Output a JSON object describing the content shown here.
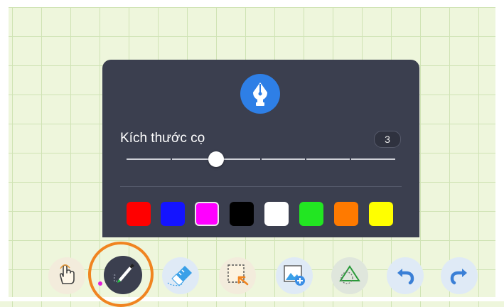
{
  "brush_panel": {
    "icon": "fountain-pen-nib-icon",
    "size_label": "Kích thước cọ",
    "size_value": "3",
    "size_slider": {
      "min": 1,
      "max": 7,
      "value": 3
    },
    "colors": [
      {
        "name": "red",
        "hex": "#ff0000",
        "selected": false
      },
      {
        "name": "blue",
        "hex": "#1414ff",
        "selected": false
      },
      {
        "name": "magenta",
        "hex": "#ff00ff",
        "selected": true
      },
      {
        "name": "black",
        "hex": "#000000",
        "selected": false
      },
      {
        "name": "white",
        "hex": "#ffffff",
        "selected": false
      },
      {
        "name": "green",
        "hex": "#22e622",
        "selected": false
      },
      {
        "name": "orange",
        "hex": "#ff7a00",
        "selected": false
      },
      {
        "name": "yellow",
        "hex": "#ffff00",
        "selected": false
      }
    ]
  },
  "toolbar": [
    {
      "id": "hand",
      "icon": "hand-pointer-icon"
    },
    {
      "id": "pen",
      "icon": "pen-icon",
      "active": true,
      "current_color": "#e01ed8"
    },
    {
      "id": "eraser",
      "icon": "eraser-icon"
    },
    {
      "id": "select",
      "icon": "selection-cursor-icon"
    },
    {
      "id": "image",
      "icon": "add-image-icon"
    },
    {
      "id": "shapes",
      "icon": "shapes-icon"
    },
    {
      "id": "undo",
      "icon": "undo-icon"
    },
    {
      "id": "redo",
      "icon": "redo-icon"
    }
  ],
  "colors": {
    "canvas_background": "#eef6dc",
    "panel_background": "#3b3f4f",
    "accent_blue": "#2e7fe6",
    "highlight_ring": "#f08420"
  }
}
